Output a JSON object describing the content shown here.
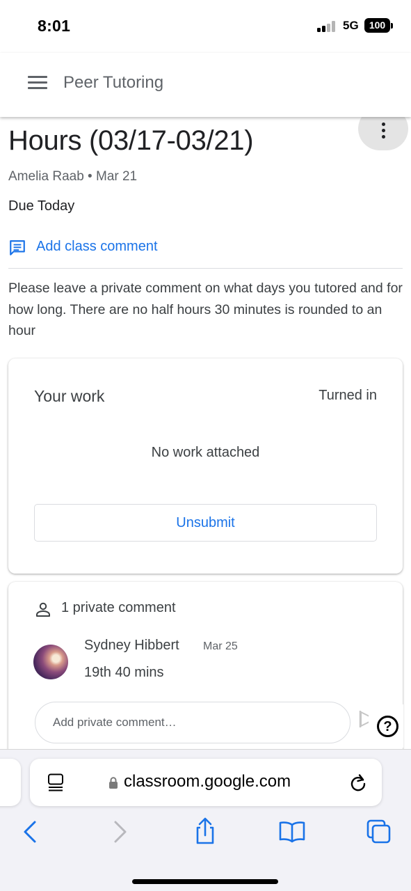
{
  "status_bar": {
    "time": "8:01",
    "network": "5G",
    "battery": "100"
  },
  "header": {
    "class_name": "Peer Tutoring"
  },
  "assignment": {
    "title": "Hours (03/17-03/21)",
    "meta": "Amelia Raab • Mar 21",
    "due": "Due Today",
    "add_class_comment": "Add class comment",
    "instructions": "Please leave a private comment on what days you tutored and for how long. There are no half hours 30 minutes is rounded to an hour"
  },
  "work": {
    "title": "Your work",
    "status": "Turned in",
    "empty_text": "No work attached",
    "unsubmit_label": "Unsubmit"
  },
  "private_comments": {
    "count_label": "1 private comment",
    "comments": [
      {
        "author": "Sydney Hibbert",
        "date": "Mar 25",
        "text": "19th 40 mins"
      }
    ],
    "input_placeholder": "Add private comment…"
  },
  "browser": {
    "url": "classroom.google.com"
  },
  "colors": {
    "accent": "#1a73e8",
    "text": "#3c4043",
    "muted": "#5f6368"
  }
}
